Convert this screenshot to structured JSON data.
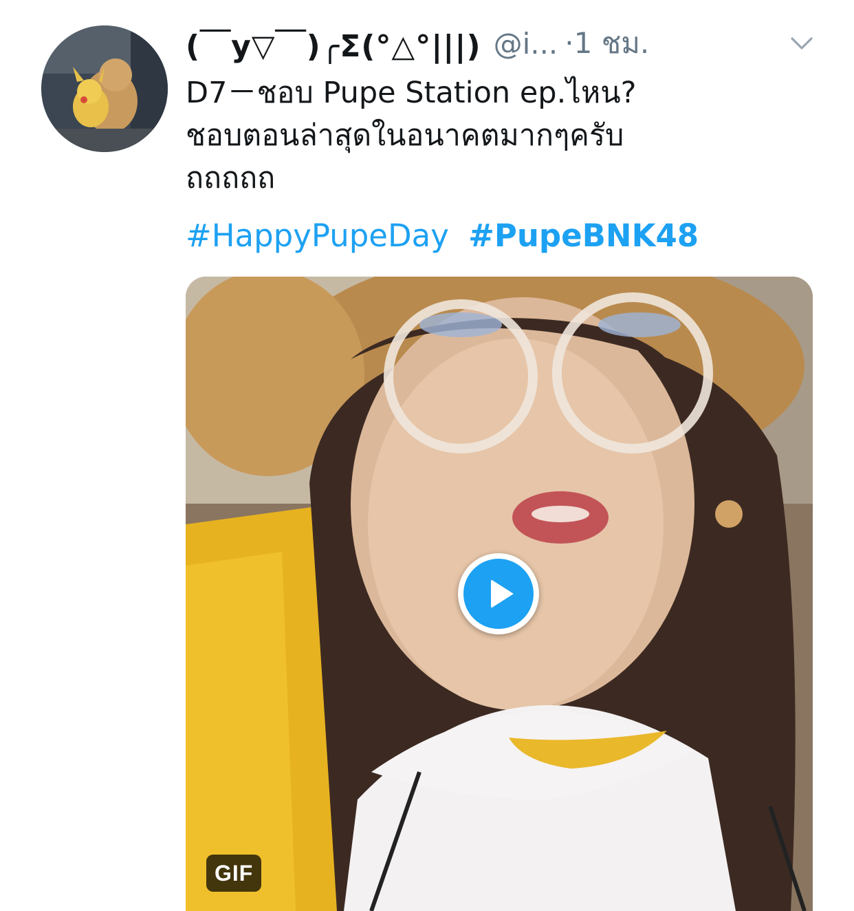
{
  "tweet": {
    "display_name": "(￣y▽￣)╭Σ(°△°|||)",
    "handle": "@i...",
    "time": "·1 ชม.",
    "text_lines": [
      "D7－ชอบ Pupe Station ep.ไหน?",
      "ชอบตอนล่าสุดในอนาคตมากๆครับ",
      "ถถถถถ"
    ],
    "hashtags": [
      "#HappyPupeDay",
      "#PupeBNK48"
    ],
    "media": {
      "badge": "GIF"
    }
  },
  "icons": {
    "menu": "chevron-down-icon",
    "play": "play-icon"
  },
  "colors": {
    "link": "#1da1f2",
    "secondary_text": "#657786",
    "primary_text": "#14171a"
  }
}
